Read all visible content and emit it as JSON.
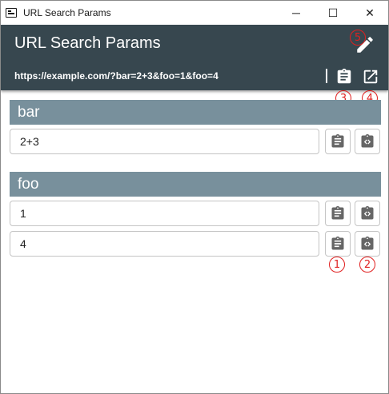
{
  "window": {
    "title": "URL Search Params",
    "controls": {
      "minimize": "─",
      "maximize": "☐",
      "close": "✕"
    }
  },
  "appbar": {
    "title": "URL Search Params",
    "url": "https://example.com/?bar=2+3&foo=1&foo=4",
    "icons": {
      "edit": "pencil-icon",
      "copy_url": "clipboard-icon",
      "open_url": "open-in-new-icon"
    }
  },
  "annotations": {
    "a1": "1",
    "a2": "2",
    "a3": "3",
    "a4": "4",
    "a5": "5"
  },
  "params": [
    {
      "name": "bar",
      "values": [
        "2+3"
      ]
    },
    {
      "name": "foo",
      "values": [
        "1",
        "4"
      ]
    }
  ],
  "row_icons": {
    "copy": "clipboard-icon",
    "encode": "code-icon"
  },
  "colors": {
    "appbar": "#37474f",
    "group_header": "#78909c",
    "annotation": "#e02020"
  }
}
